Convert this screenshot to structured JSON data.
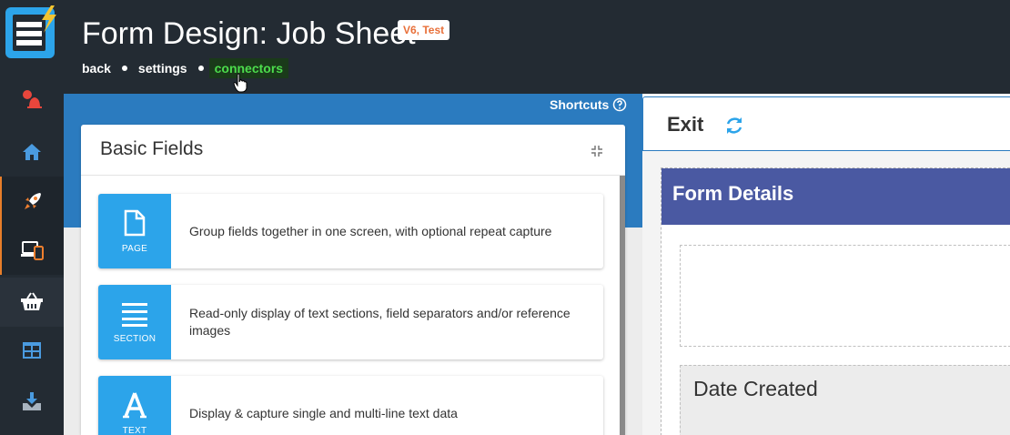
{
  "header": {
    "title": "Form Design: Job Sheet",
    "version_badge": "V6, Test",
    "breadcrumbs": [
      "back",
      "settings",
      "connectors"
    ]
  },
  "nav": {
    "items": [
      {
        "icon": "alert-bell-icon",
        "color": "#e8463c"
      },
      {
        "icon": "home-icon",
        "color": "#4a9be0"
      },
      {
        "icon": "rocket-icon",
        "color": "#f07f2e"
      },
      {
        "icon": "devices-icon",
        "color": "#f07f2e"
      },
      {
        "icon": "basket-icon",
        "color": "#ffffff"
      },
      {
        "icon": "dashboard-icon",
        "color": "#4a9be0"
      },
      {
        "icon": "download-icon",
        "color": "#4a9be0"
      }
    ]
  },
  "shortcuts_label": "Shortcuts",
  "basic_fields": {
    "title": "Basic Fields",
    "items": [
      {
        "tile": "PAGE",
        "icon": "page-icon",
        "description": "Group fields together in one screen, with optional repeat capture"
      },
      {
        "tile": "SECTION",
        "icon": "section-icon",
        "description": "Read-only display of text sections, field separators and/or reference images"
      },
      {
        "tile": "TEXT",
        "icon": "text-icon",
        "description": "Display & capture single and multi-line text data"
      }
    ]
  },
  "canvas": {
    "exit_label": "Exit",
    "section_title": "Form Details",
    "date_field_label": "Date Created"
  },
  "colors": {
    "header_bg": "#232b33",
    "accent_blue": "#2b7bbf",
    "tile_blue": "#2ca4ea",
    "section_purple": "#4a59a2",
    "badge_text": "#e8703a",
    "active_crumb": "#4cdc4c"
  }
}
